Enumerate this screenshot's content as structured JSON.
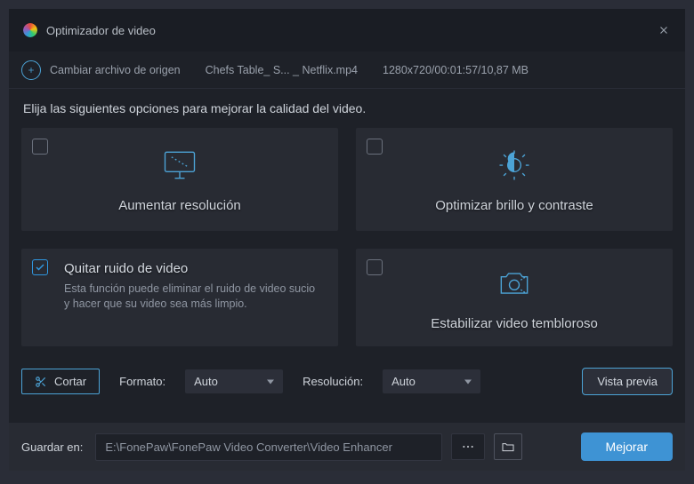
{
  "window": {
    "title": "Optimizador de video"
  },
  "source": {
    "change_label": "Cambiar archivo de origen",
    "filename": "Chefs Table_ S... _ Netflix.mp4",
    "meta": "1280x720/00:01:57/10,87 MB"
  },
  "instruction": "Elija las siguientes opciones para mejorar la calidad del video.",
  "cards": {
    "upscale": {
      "title": "Aumentar resolución",
      "checked": false
    },
    "brightness": {
      "title": "Optimizar brillo y contraste",
      "checked": false
    },
    "denoise": {
      "title": "Quitar ruido de video",
      "desc": "Esta función puede eliminar el ruido de video sucio y hacer que su video sea más limpio.",
      "checked": true
    },
    "stabilize": {
      "title": "Estabilizar video tembloroso",
      "checked": false
    }
  },
  "controls": {
    "cut_label": "Cortar",
    "format_label": "Formato:",
    "format_value": "Auto",
    "resolution_label": "Resolución:",
    "resolution_value": "Auto",
    "preview_label": "Vista previa"
  },
  "footer": {
    "save_label": "Guardar en:",
    "path_value": "E:\\FonePaw\\FonePaw Video Converter\\Video Enhancer",
    "enhance_label": "Mejorar"
  }
}
